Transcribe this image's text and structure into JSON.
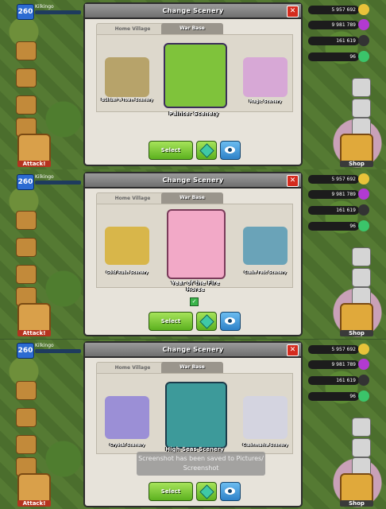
{
  "hud": {
    "level": "260",
    "player_name": "Kilkingo",
    "attack_label": "Attack!",
    "shop_label": "Shop",
    "gold": "5 957 692",
    "elixir": "9 981 789",
    "dark_elixir": "161 619",
    "gems": "96"
  },
  "dialogs": [
    {
      "title": "Change Scenery",
      "tab_home": "Home Village",
      "tab_war": "War Base",
      "scenes": [
        {
          "name": "Builder's Town Scenery",
          "color": "#b7a36a"
        },
        {
          "name": "Painter Scenery",
          "color": "#7fc33b"
        },
        {
          "name": "Magic Scenery",
          "color": "#d7a8d6"
        }
      ],
      "select_label": "Select"
    },
    {
      "title": "Change Scenery",
      "tab_home": "Home Village",
      "tab_war": "War Base",
      "scenes": [
        {
          "name": "Gold Rush Scenery",
          "color": "#d8b64a"
        },
        {
          "name": "Year of the Fire Horse",
          "color": "#f2a9c7"
        },
        {
          "name": "Clash Fest Scenery",
          "color": "#6aa3b8"
        }
      ],
      "select_label": "Select"
    },
    {
      "title": "Change Scenery",
      "tab_home": "Home Village",
      "tab_war": "War Base",
      "scenes": [
        {
          "name": "Crystal Scenery",
          "color": "#9b8fd6"
        },
        {
          "name": "High Seas Scenery",
          "color": "#3d9a9a"
        },
        {
          "name": "Clashmania Scenery",
          "color": "#d4d4e0"
        }
      ],
      "select_label": "Select"
    }
  ],
  "toast": "Screenshot has been saved to Pictures/ Screenshot"
}
